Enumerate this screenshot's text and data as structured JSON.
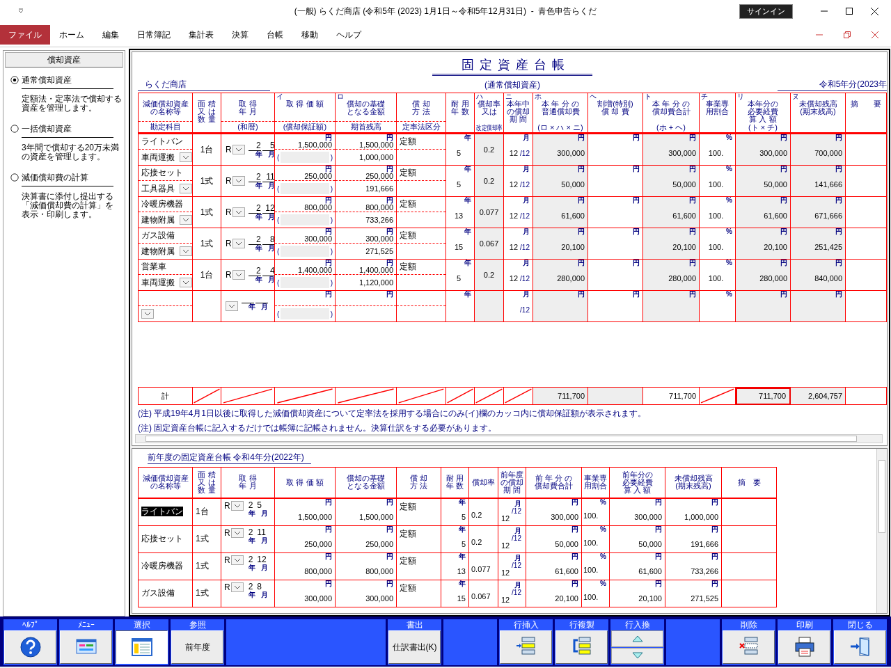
{
  "window": {
    "title": "(一般) らくだ商店 (令和5年 (2023) 1月1日～令和5年12月31日)  -  青色申告らくだ",
    "sign_in": "サインイン"
  },
  "menu": [
    {
      "label": "ファイル",
      "selected": true
    },
    {
      "label": "ホーム",
      "selected": false
    },
    {
      "label": "編集",
      "selected": false
    },
    {
      "label": "日常簿記",
      "selected": false
    },
    {
      "label": "集計表",
      "selected": false
    },
    {
      "label": "決算",
      "selected": false
    },
    {
      "label": "台帳",
      "selected": false
    },
    {
      "label": "移動",
      "selected": false
    },
    {
      "label": "ヘルプ",
      "selected": false
    }
  ],
  "sidebar": {
    "header": "償却資産",
    "options": [
      {
        "label": "通常償却資産",
        "description": "定額法・定率法で償却する資産を管理します。",
        "selected": true
      },
      {
        "label": "一括償却資産",
        "description": "3年間で償却する20万未満の資産を管理します。",
        "selected": false
      },
      {
        "label": "減価償却費の計算",
        "description": "決算書に添付し提出する「減価償却費の計算」を表示・印刷します。",
        "selected": false
      }
    ]
  },
  "ledger": {
    "title": "固定資産台帳",
    "subtitle": "(通常償却資産)",
    "company": "らくだ商店",
    "period": "令和5年分(2023年",
    "columns": [
      {
        "top": [
          "減価償却資産",
          "の名称等"
        ],
        "bottom": "勘定科目"
      },
      {
        "top": [
          "面 積",
          "又 は",
          "数 量"
        ]
      },
      {
        "top": [
          "取 得",
          "年 月"
        ],
        "bottom": "(和暦)"
      },
      {
        "mark": "イ",
        "top": [
          "取 得 価 額"
        ],
        "bottom": "(償却保証額)"
      },
      {
        "mark": "ロ",
        "top": [
          "償却の基礎",
          "となる金額"
        ],
        "bottom": "期首残高"
      },
      {
        "top": [
          "償 却",
          "方 法"
        ],
        "bottom": "定率法区分"
      },
      {
        "top": [
          "耐 用",
          "年 数"
        ]
      },
      {
        "mark": "ハ",
        "top": [
          "償却率",
          "又は"
        ],
        "bottom": "改定償却率"
      },
      {
        "mark": "ニ",
        "top": [
          "本年中",
          "の償却",
          "期 間"
        ]
      },
      {
        "mark": "ホ",
        "top": [
          "本 年 分 の",
          "普通償却費"
        ],
        "bottom": "(ロ × ハ × ニ)"
      },
      {
        "mark": "ヘ",
        "top": [
          "割増(特別)",
          "償 却 費"
        ]
      },
      {
        "mark": "ト",
        "top": [
          "本 年 分 の",
          "償却費合計"
        ],
        "bottom": "(ホ + ヘ)"
      },
      {
        "mark": "チ",
        "top": [
          "事業専",
          "用割合"
        ]
      },
      {
        "mark": "リ",
        "top": [
          "本年分の",
          "必要経費",
          "算 入 額"
        ],
        "bottom": "(ト × チ)"
      },
      {
        "mark": "ヌ",
        "top": [
          "未償却残高",
          "(期末残高)"
        ]
      },
      {
        "top": [
          "摘　　要"
        ]
      }
    ],
    "rows": [
      {
        "name": "ライトバン",
        "account": "車両運搬",
        "quantity": "1台",
        "era": "R",
        "year": "2",
        "month": "5",
        "cost": "1,500,000",
        "base": "1,500,000",
        "opening": "1,000,000",
        "method": "定額",
        "life": "5",
        "rate": "0.2",
        "months": "12",
        "ho": "300,000",
        "to": "300,000",
        "ratio": "100.",
        "ri": "300,000",
        "nu": "700,000",
        "units": {
          "year": "年",
          "month": "月",
          "cost": "円",
          "lparen": "(",
          "rparen": ")",
          "base": "円",
          "life": "年",
          "months": "月",
          "per12": "/12",
          "ho": "円",
          "he": "円",
          "to": "円",
          "ratio": "%",
          "ri": "円",
          "nu": "円"
        }
      },
      {
        "name": "応接セット",
        "account": "工具器具",
        "quantity": "1式",
        "era": "R",
        "year": "2",
        "month": "11",
        "cost": "250,000",
        "base": "250,000",
        "opening": "191,666",
        "method": "定額",
        "life": "5",
        "rate": "0.2",
        "months": "12",
        "ho": "50,000",
        "to": "50,000",
        "ratio": "100.",
        "ri": "50,000",
        "nu": "141,666",
        "units": {
          "year": "年",
          "month": "月",
          "cost": "円",
          "lparen": "(",
          "rparen": ")",
          "base": "円",
          "life": "年",
          "months": "月",
          "per12": "/12",
          "ho": "円",
          "he": "円",
          "to": "円",
          "ratio": "%",
          "ri": "円",
          "nu": "円"
        }
      },
      {
        "name": "冷暖房機器",
        "account": "建物附属",
        "quantity": "1式",
        "era": "R",
        "year": "2",
        "month": "12",
        "cost": "800,000",
        "base": "800,000",
        "opening": "733,266",
        "method": "定額",
        "life": "13",
        "rate": "0.077",
        "months": "12",
        "ho": "61,600",
        "to": "61,600",
        "ratio": "100.",
        "ri": "61,600",
        "nu": "671,666",
        "units": {
          "year": "年",
          "month": "月",
          "cost": "円",
          "lparen": "(",
          "rparen": ")",
          "base": "円",
          "life": "年",
          "months": "月",
          "per12": "/12",
          "ho": "円",
          "he": "円",
          "to": "円",
          "ratio": "%",
          "ri": "円",
          "nu": "円"
        }
      },
      {
        "name": "ガス設備",
        "account": "建物附属",
        "quantity": "1式",
        "era": "R",
        "year": "2",
        "month": "8",
        "cost": "300,000",
        "base": "300,000",
        "opening": "271,525",
        "method": "定額",
        "life": "15",
        "rate": "0.067",
        "months": "12",
        "ho": "20,100",
        "to": "20,100",
        "ratio": "100.",
        "ri": "20,100",
        "nu": "251,425",
        "units": {
          "year": "年",
          "month": "月",
          "cost": "円",
          "lparen": "(",
          "rparen": ")",
          "base": "円",
          "life": "年",
          "months": "月",
          "per12": "/12",
          "ho": "円",
          "he": "円",
          "to": "円",
          "ratio": "%",
          "ri": "円",
          "nu": "円"
        }
      },
      {
        "name": "営業車",
        "account": "車両運搬",
        "quantity": "1台",
        "era": "R",
        "year": "2",
        "month": "4",
        "cost": "1,400,000",
        "base": "1,400,000",
        "opening": "1,120,000",
        "method": "定額",
        "life": "5",
        "rate": "0.2",
        "months": "12",
        "ho": "280,000",
        "to": "280,000",
        "ratio": "100.",
        "ri": "280,000",
        "nu": "840,000",
        "units": {
          "year": "年",
          "month": "月",
          "cost": "円",
          "lparen": "(",
          "rparen": ")",
          "base": "円",
          "life": "年",
          "months": "月",
          "per12": "/12",
          "ho": "円",
          "he": "円",
          "to": "円",
          "ratio": "%",
          "ri": "円",
          "nu": "円"
        }
      },
      {
        "units": {
          "year": "年",
          "month": "月",
          "cost": "円",
          "lparen": "(",
          "rparen": ")",
          "base": "円",
          "life": "年",
          "months": "月",
          "per12": "/12",
          "ho": "円",
          "he": "円",
          "to": "円",
          "ratio": "%",
          "ri": "円",
          "nu": "円"
        }
      }
    ],
    "total": {
      "label": "計",
      "ho": "711,700",
      "to": "711,700",
      "ri": "711,700",
      "nu": "2,604,757",
      "ri_selected": true
    },
    "notes": [
      "(注) 平成19年4月1日以後に取得した減価償却資産について定率法を採用する場合にのみ(イ)欄のカッコ内に償却保証額が表示されます。",
      "(注) 固定資産台帳に記入するだけでは帳簿に記帳されません。決算仕訳をする必要があります。"
    ]
  },
  "previous": {
    "title": "前年度の固定資産台帳 令和4年分(2022年)",
    "columns": [
      [
        "減価償却資産",
        "の名称等"
      ],
      [
        "面 積",
        "又 は",
        "数 量"
      ],
      [
        "取 得",
        "年 月"
      ],
      [
        "取 得 価 額"
      ],
      [
        "償却の基礎",
        "となる金額"
      ],
      [
        "償 却",
        "方 法"
      ],
      [
        "耐 用",
        "年 数"
      ],
      [
        "償却率"
      ],
      [
        "前年度",
        "の償却",
        "期 間"
      ],
      [
        "前 年 分 の",
        "償却費合計"
      ],
      [
        "事業専",
        "用割合"
      ],
      [
        "前年分の",
        "必要経費",
        "算 入 額"
      ],
      [
        "未償却残高",
        "(期末残高)"
      ],
      [
        "摘　要"
      ]
    ],
    "rows": [
      {
        "name": "ライトバン",
        "selected": true,
        "quantity": "1台",
        "era": "R",
        "year": "2",
        "month": "5",
        "cost": "1,500,000",
        "base": "1,500,000",
        "method": "定額",
        "life": "5",
        "rate": "0.2",
        "months": "12",
        "total": "300,000",
        "ratio": "100.",
        "expense": "300,000",
        "balance": "1,000,000",
        "units": {
          "year": "年",
          "month": "月",
          "cost": "円",
          "base": "円",
          "life": "年",
          "months": "月",
          "per12": "/12",
          "total": "円",
          "ratio": "%",
          "expense": "円",
          "balance": "円"
        }
      },
      {
        "name": "応接セット",
        "selected": false,
        "quantity": "1式",
        "era": "R",
        "year": "2",
        "month": "11",
        "cost": "250,000",
        "base": "250,000",
        "method": "定額",
        "life": "5",
        "rate": "0.2",
        "months": "12",
        "total": "50,000",
        "ratio": "100.",
        "expense": "50,000",
        "balance": "191,666",
        "units": {
          "year": "年",
          "month": "月",
          "cost": "円",
          "base": "円",
          "life": "年",
          "months": "月",
          "per12": "/12",
          "total": "円",
          "ratio": "%",
          "expense": "円",
          "balance": "円"
        }
      },
      {
        "name": "冷暖房機器",
        "selected": false,
        "quantity": "1式",
        "era": "R",
        "year": "2",
        "month": "12",
        "cost": "800,000",
        "base": "800,000",
        "method": "定額",
        "life": "13",
        "rate": "0.077",
        "months": "12",
        "total": "61,600",
        "ratio": "100.",
        "expense": "61,600",
        "balance": "733,266",
        "units": {
          "year": "年",
          "month": "月",
          "cost": "円",
          "base": "円",
          "life": "年",
          "months": "月",
          "per12": "/12",
          "total": "円",
          "ratio": "%",
          "expense": "円",
          "balance": "円"
        }
      },
      {
        "name": "ガス設備",
        "selected": false,
        "quantity": "1式",
        "era": "R",
        "year": "2",
        "month": "8",
        "cost": "300,000",
        "base": "300,000",
        "method": "定額",
        "life": "15",
        "rate": "0.067",
        "months": "12",
        "total": "20,100",
        "ratio": "100.",
        "expense": "20,100",
        "balance": "271,525",
        "units": {
          "year": "年",
          "month": "月",
          "cost": "円",
          "base": "円",
          "life": "年",
          "months": "月",
          "per12": "/12",
          "total": "円",
          "ratio": "%",
          "expense": "円",
          "balance": "円"
        }
      }
    ]
  },
  "toolbar": [
    {
      "kind": "icon",
      "label": "ﾍﾙﾌﾟ",
      "selected": false
    },
    {
      "kind": "icon",
      "label": "ﾒﾆｭｰ",
      "selected": false
    },
    {
      "kind": "icon",
      "label": "選択",
      "selected": true
    },
    {
      "kind": "text",
      "label": "参照",
      "button": "前年度",
      "selected": false
    },
    {
      "kind": "spacer"
    },
    {
      "kind": "text",
      "label": "書出",
      "button": "仕訳書出(K)",
      "selected": false
    },
    {
      "kind": "gap"
    },
    {
      "kind": "icon",
      "label": "行挿入",
      "selected": false
    },
    {
      "kind": "icon",
      "label": "行複製",
      "selected": false
    },
    {
      "kind": "split",
      "label": "行入換"
    },
    {
      "kind": "gap"
    },
    {
      "kind": "icon",
      "label": "削除",
      "selected": false
    },
    {
      "kind": "icon",
      "label": "印刷",
      "selected": false
    },
    {
      "kind": "icon",
      "label": "閉じる",
      "selected": false
    }
  ]
}
